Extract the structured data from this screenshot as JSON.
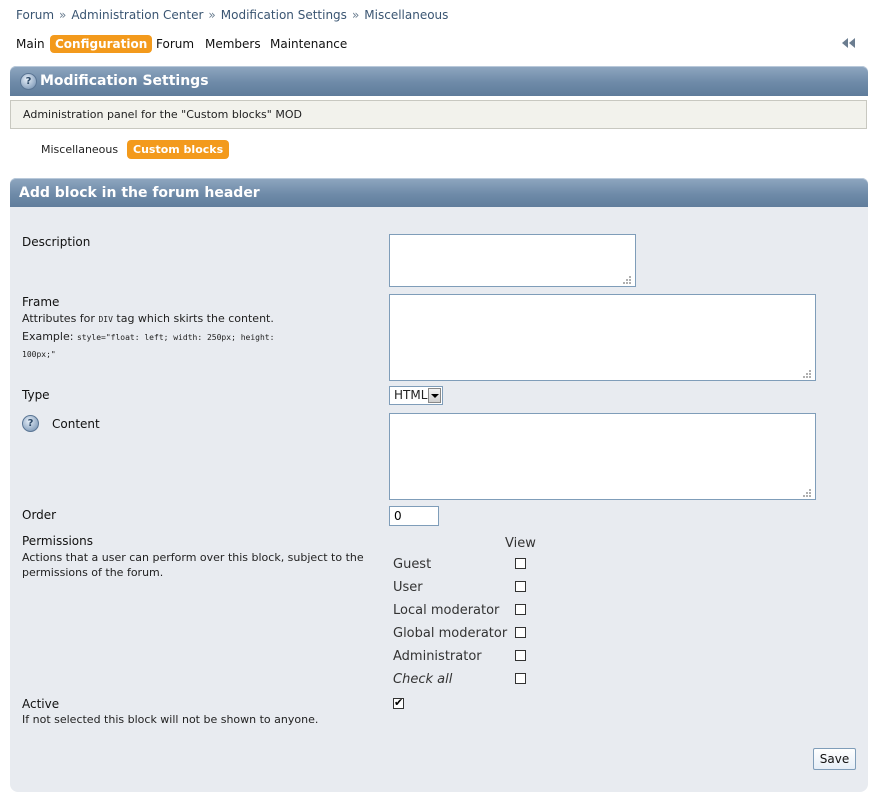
{
  "breadcrumb": [
    "Forum",
    "Administration Center",
    "Modification Settings",
    "Miscellaneous"
  ],
  "breadcrumb_sep": "»",
  "topnav": [
    {
      "label": "Main",
      "active": false
    },
    {
      "label": "Configuration",
      "active": true
    },
    {
      "label": "Forum",
      "active": false
    },
    {
      "label": "Members",
      "active": false
    },
    {
      "label": "Maintenance",
      "active": false
    }
  ],
  "collapse_icon": "double-chevron-left-icon",
  "header": {
    "title": "Modification Settings",
    "description": "Administration panel for the \"Custom blocks\" MOD",
    "help_icon": "?"
  },
  "subnav": [
    {
      "label": "Miscellaneous",
      "active": false
    },
    {
      "label": "Custom blocks",
      "active": true
    }
  ],
  "form": {
    "title": "Add block in the forum header",
    "description_label": "Description",
    "description_value": "",
    "frame_label": "Frame",
    "frame_help_pre": "Attributes for",
    "frame_help_tag": "DIV",
    "frame_help_post": "tag which skirts the content.",
    "frame_example_label": "Example:",
    "frame_example_code_1": "style=\"float: left; width: 250px; height:",
    "frame_example_code_2": "100px;\"",
    "frame_value": "",
    "type_label": "Type",
    "type_value": "HTML",
    "content_label": "Content",
    "content_help_icon": "?",
    "content_value": "",
    "order_label": "Order",
    "order_value": "0",
    "permissions_label": "Permissions",
    "permissions_help": "Actions that a user can perform over this block, subject to the permissions of the forum.",
    "permissions_column": "View",
    "permissions": [
      {
        "role": "Guest",
        "checked": false
      },
      {
        "role": "User",
        "checked": false
      },
      {
        "role": "Local moderator",
        "checked": false
      },
      {
        "role": "Global moderator",
        "checked": false
      },
      {
        "role": "Administrator",
        "checked": false
      },
      {
        "role": "Check all",
        "checked": false
      }
    ],
    "active_label": "Active",
    "active_help": "If not selected this block will not be shown to anyone.",
    "active_checked": true,
    "save_label": "Save"
  },
  "colors": {
    "accent": "#f39a1c",
    "panel_header": "#6e8aa8",
    "form_bg": "#e8ebf0"
  }
}
